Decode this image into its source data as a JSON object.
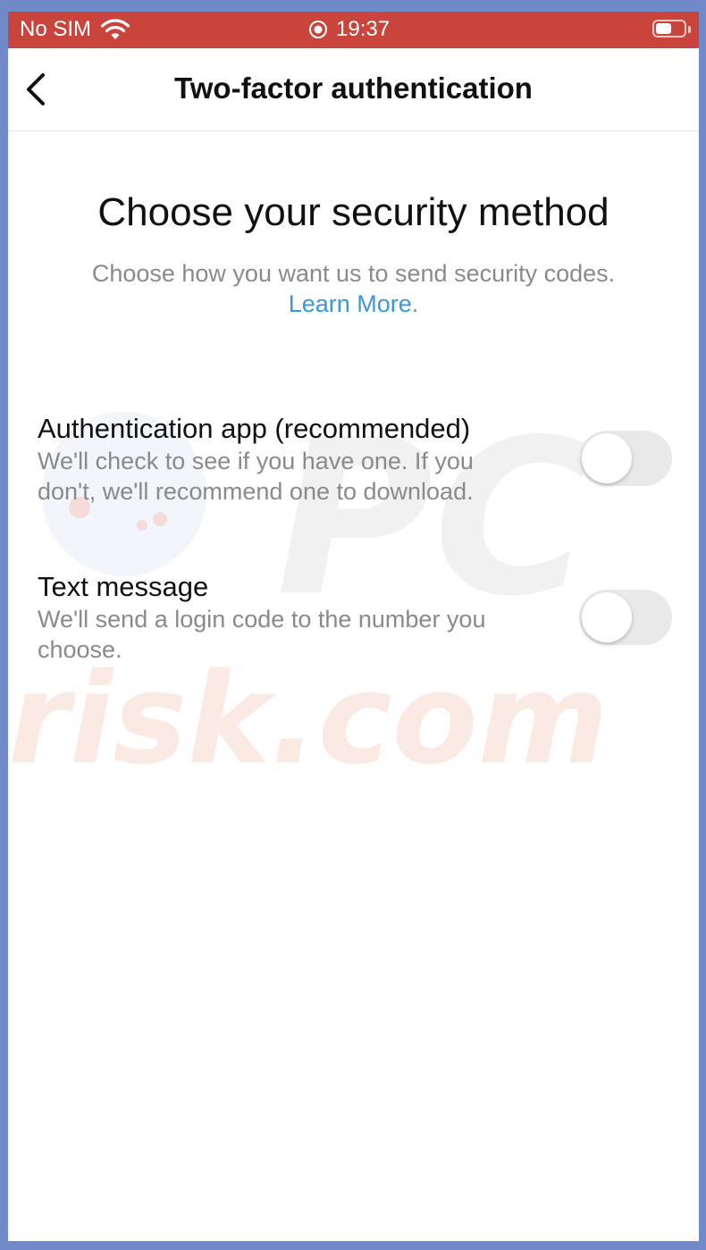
{
  "status_bar": {
    "carrier": "No SIM",
    "time": "19:37",
    "battery_level": 0.55
  },
  "nav": {
    "title": "Two-factor authentication",
    "back_icon": "chevron-left-icon"
  },
  "main": {
    "heading": "Choose your security method",
    "subtext": "Choose how you want us to send security codes.",
    "learn_more": "Learn More",
    "learn_more_suffix": "."
  },
  "options": [
    {
      "title": "Authentication app (recommended)",
      "description": "We'll check to see if you have one. If you don't, we'll recommend one to download.",
      "enabled": false
    },
    {
      "title": "Text message",
      "description": "We'll send a login code to the number you choose.",
      "enabled": false
    }
  ],
  "watermark": {
    "text_top": "PC",
    "text_bottom": "risk.com"
  },
  "colors": {
    "status_bar": "#c9453c",
    "link": "#3a96e0",
    "toggle_off": "#e9e9ea"
  }
}
